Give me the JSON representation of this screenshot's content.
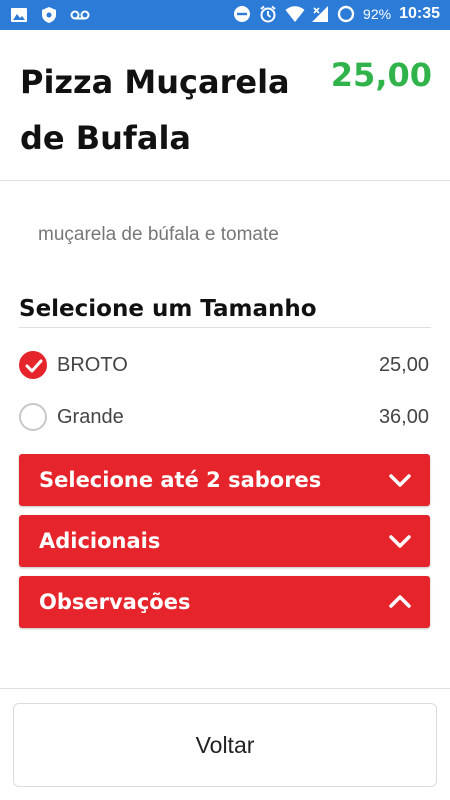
{
  "status_bar": {
    "battery": "92%",
    "time": "10:35",
    "icons": [
      "image-icon",
      "shield-icon",
      "voicemail-icon",
      "dnd-icon",
      "alarm-icon",
      "wifi-icon",
      "signal-icon",
      "sync-icon"
    ]
  },
  "product": {
    "name": "Pizza Muçarela de Bufala",
    "price": "25,00",
    "description": "muçarela de búfala e tomate"
  },
  "size_section": {
    "title": "Selecione um Tamanho",
    "options": [
      {
        "label": "BROTO",
        "price": "25,00",
        "selected": true
      },
      {
        "label": "Grande",
        "price": "36,00",
        "selected": false
      }
    ]
  },
  "accordions": [
    {
      "label": "Selecione até 2 sabores",
      "icon": "chevron-down-icon"
    },
    {
      "label": "Adicionais",
      "icon": "chevron-down-icon"
    },
    {
      "label": "Observações",
      "icon": "chevron-up-icon"
    }
  ],
  "footer": {
    "back_label": "Voltar"
  },
  "colors": {
    "status_bar": "#2b7bd7",
    "accent_red": "#e6242b",
    "price_green": "#2fb34a"
  }
}
